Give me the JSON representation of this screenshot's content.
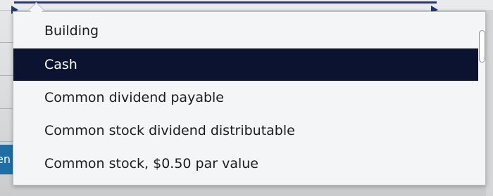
{
  "dropdown": {
    "options": [
      {
        "label": "Building",
        "selected": false
      },
      {
        "label": "Cash",
        "selected": true
      },
      {
        "label": "Common dividend payable",
        "selected": false
      },
      {
        "label": "Common stock dividend distributable",
        "selected": false
      },
      {
        "label": "Common stock, $0.50 par value",
        "selected": false
      }
    ],
    "selected_value": "Cash"
  },
  "background": {
    "partial_button_text": "en"
  },
  "colors": {
    "selected_bg": "#0c1330",
    "selected_text": "#ffffff",
    "list_bg": "#f4f5f6",
    "button_blue": "#1f6fa6"
  }
}
